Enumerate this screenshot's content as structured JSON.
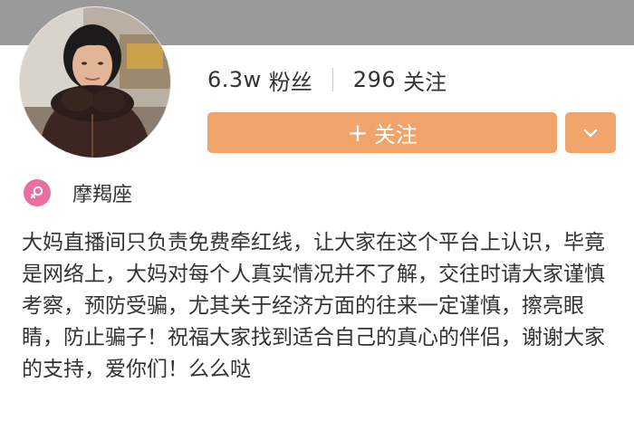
{
  "profile": {
    "fans_count": "6.3w",
    "fans_label": "粉丝",
    "following_count": "296",
    "following_label": "关注",
    "follow_button": {
      "icon": "plus-icon",
      "label": "关注"
    },
    "more_button": {
      "icon": "chevron-down-icon"
    },
    "sign": "摩羯座",
    "gender_icon": "female-icon",
    "bio": "大妈直播间只负责免费牵红线，让大家在这个平台上认识，毕竟是网络上，大妈对每个人真实情况并不了解，交往时请大家谨慎考察，预防受骗，尤其关于经济方面的往来一定谨慎，擦亮眼睛，防止骗子！祝福大家找到适合自己的真心的伴侣，谢谢大家的支持，爱你们！么么哒"
  },
  "colors": {
    "header_band": "#9a9a9a",
    "accent": "#f0a36b",
    "gender_badge": "#e9709e",
    "text": "#333333"
  }
}
